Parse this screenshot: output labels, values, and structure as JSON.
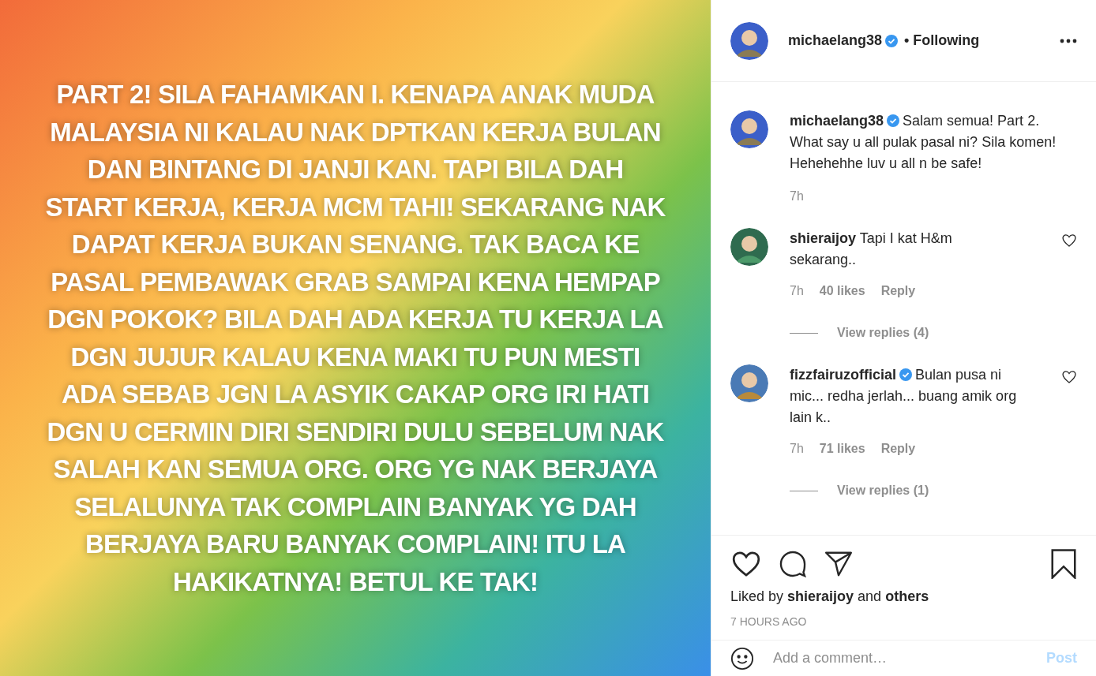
{
  "post_image": {
    "text": "PART 2! SILA FAHAMKAN I. KENAPA ANAK MUDA MALAYSIA NI KALAU NAK DPTKAN KERJA BULAN DAN BINTANG DI JANJI KAN. TAPI BILA DAH START KERJA, KERJA MCM TAHI! SEKARANG NAK DAPAT KERJA BUKAN SENANG. TAK BACA KE PASAL PEMBAWAK GRAB SAMPAI KENA HEMPAP DGN POKOK? BILA DAH ADA KERJA TU KERJA LA DGN JUJUR KALAU KENA MAKI TU PUN MESTI ADA SEBAB JGN LA ASYIK CAKAP ORG IRI HATI DGN U CERMIN DIRI SENDIRI DULU SEBELUM NAK SALAH KAN SEMUA ORG. ORG YG NAK BERJAYA SELALUNYA TAK COMPLAIN BANYAK YG DAH BERJAYA BARU BANYAK COMPLAIN! ITU LA HAKIKATNYA! BETUL KE TAK!"
  },
  "header": {
    "username": "michaelang38",
    "verified": true,
    "follow_status": "• Following"
  },
  "caption": {
    "username": "michaelang38",
    "verified": true,
    "text": "Salam semua! Part 2. What say u all pulak pasal ni? Sila komen! Hehehehhe luv u all n be safe!",
    "time": "7h"
  },
  "comments": [
    {
      "username": "shieraijoy",
      "verified": false,
      "text": "Tapi I kat H&m sekarang..",
      "time": "7h",
      "likes": "40 likes",
      "reply": "Reply",
      "view_replies": "View replies (4)"
    },
    {
      "username": "fizzfairuzofficial",
      "verified": true,
      "text": "Bulan pusa ni mic... redha jerlah... buang amik org lain k..",
      "time": "7h",
      "likes": "71 likes",
      "reply": "Reply",
      "view_replies": "View replies (1)"
    }
  ],
  "liked_by": "Liked by **shieraijoy** and **others**",
  "timestamp": "7 HOURS AGO",
  "add_comment": {
    "placeholder": "Add a comment…",
    "post_button": "Post",
    "disabled": true
  }
}
